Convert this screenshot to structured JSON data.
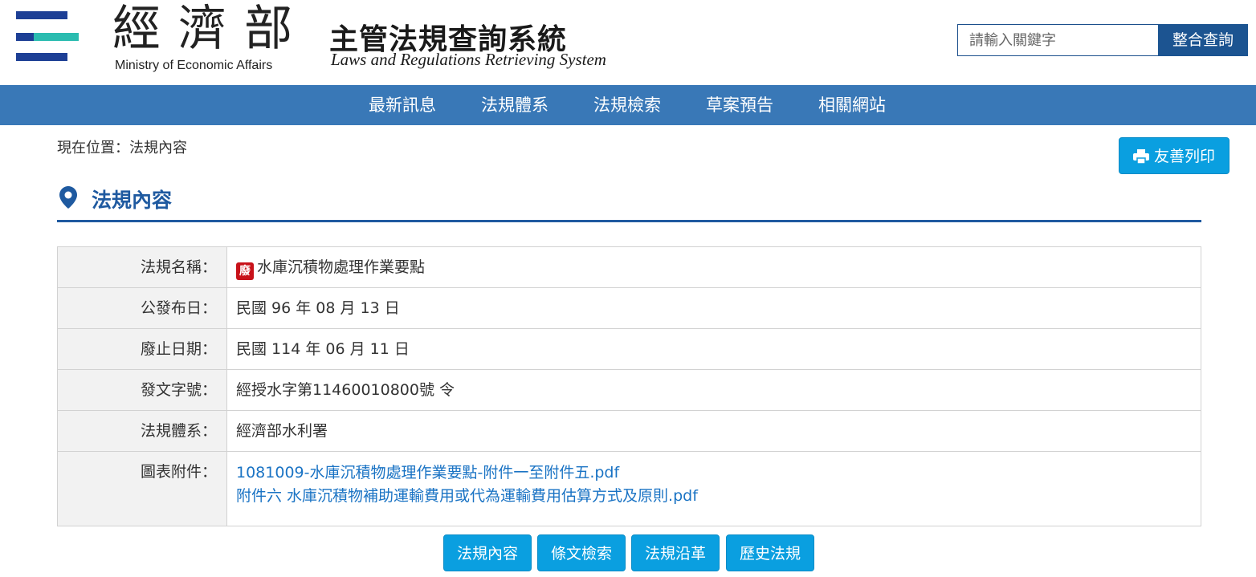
{
  "header": {
    "org_name_cn": "經濟部",
    "org_name_en": "Ministry of Economic Affairs",
    "system_name_cn": "主管法規查詢系統",
    "system_name_en": "Laws and Regulations Retrieving System",
    "search": {
      "placeholder": "請輸入關鍵字",
      "button_label": "整合查詢"
    }
  },
  "nav": {
    "items": [
      {
        "label": "最新訊息"
      },
      {
        "label": "法規體系"
      },
      {
        "label": "法規檢索"
      },
      {
        "label": "草案預告"
      },
      {
        "label": "相關網站"
      }
    ]
  },
  "breadcrumb": "現在位置：法規內容",
  "print_button": {
    "label": "友善列印",
    "icon": "printer-icon"
  },
  "section": {
    "title": "法規內容",
    "icon": "map-pin-icon"
  },
  "regulation": {
    "rows": [
      {
        "label": "法規名稱：",
        "value": "水庫沉積物處理作業要點",
        "badge": "廢"
      },
      {
        "label": "公發布日：",
        "value": "民國 96 年 08 月 13 日"
      },
      {
        "label": "廢止日期：",
        "value": "民國 114 年 06 月 11 日"
      },
      {
        "label": "發文字號：",
        "value": "經授水字第11460010800號 令"
      },
      {
        "label": "法規體系：",
        "value": "經濟部水利署"
      }
    ],
    "attachments_label": "圖表附件：",
    "attachments": [
      "1081009-水庫沉積物處理作業要點-附件一至附件五.pdf",
      "附件六 水庫沉積物補助運輸費用或代為運輸費用估算方式及原則.pdf"
    ]
  },
  "tabs": [
    {
      "label": "法規內容"
    },
    {
      "label": "條文檢索"
    },
    {
      "label": "法規沿革"
    },
    {
      "label": "歷史法規"
    }
  ],
  "colors": {
    "nav_bg": "#3978b7",
    "accent": "#0a9fe0",
    "title_blue": "#1f5aa0",
    "link": "#1a73c4",
    "badge_red": "#c8121a"
  }
}
